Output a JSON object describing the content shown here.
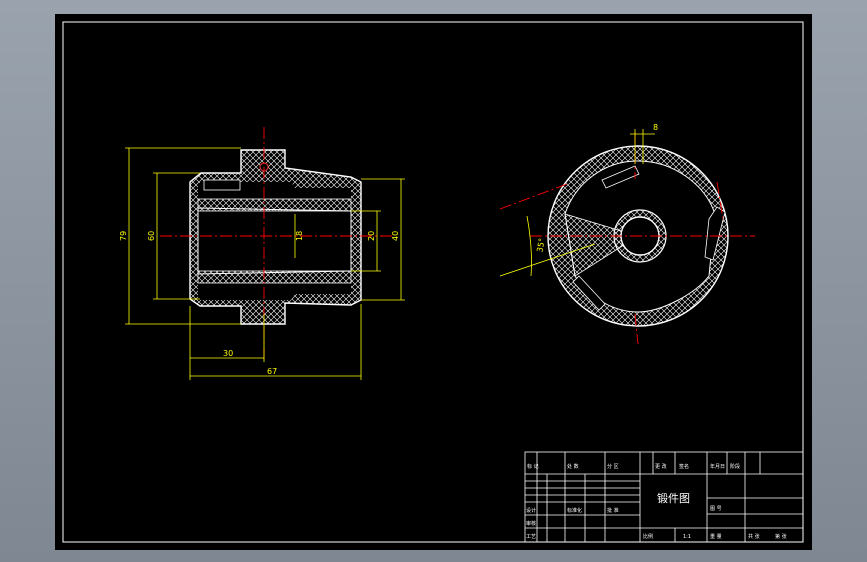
{
  "colors": {
    "background": "#000000",
    "frame": "#ffffff",
    "outline": "#ffffff",
    "centerline": "#ff0000",
    "dimension": "#ffff00",
    "hatch": "#ffffff"
  },
  "front_view": {
    "dimensions": {
      "overall_height": "79",
      "inner_height": "60",
      "bore": "18",
      "right_inner": "20",
      "right_outer": "40",
      "half_length": "30",
      "length": "67"
    }
  },
  "side_view": {
    "dimensions": {
      "slot_width": "8",
      "angle": "35°"
    }
  },
  "title_block": {
    "drawing_name": "锻件图",
    "row1": [
      "标 记",
      "处 数",
      "分 区",
      "更 改",
      "签名",
      "年月日",
      "阶段"
    ],
    "left_labels": [
      "设计",
      "审核",
      "工艺"
    ],
    "standard": "标准化",
    "approve": "批 准",
    "scale": "比例",
    "sheet": "共 张",
    "sheet_no": "第 张",
    "code": "图 号",
    "weight": "重 量",
    "ratio": "1:1"
  }
}
